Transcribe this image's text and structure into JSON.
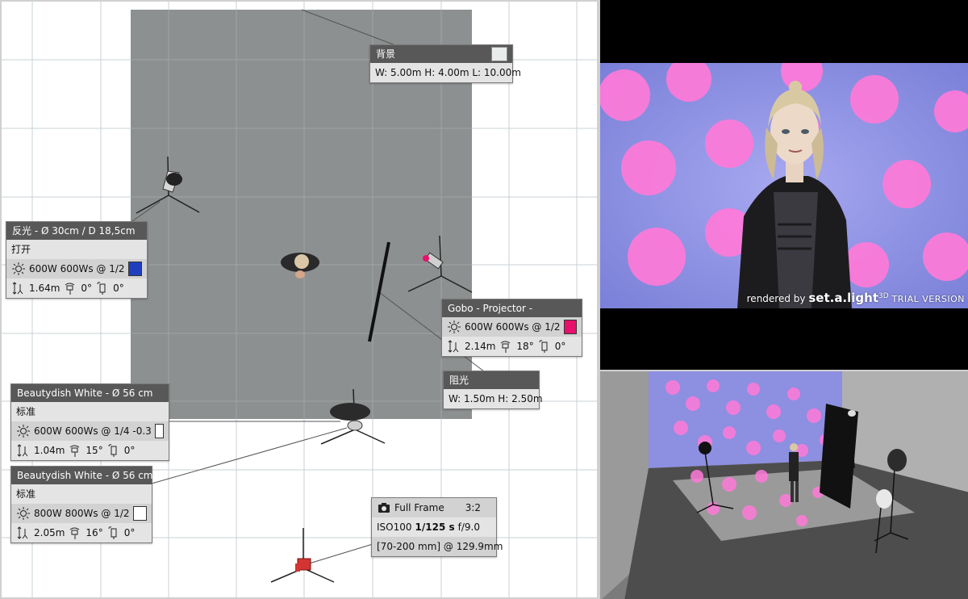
{
  "background_card": {
    "title": "背景",
    "dims": "W: 5.00m H: 4.00m L: 10.00m",
    "swatch_color": "#e8ecea"
  },
  "reflector_card": {
    "title": "反光 - Ø 30cm / D 18,5cm",
    "state": "打开",
    "power": "600W 600Ws @ 1/2",
    "swatch_color": "#1f3fbf",
    "height": "1.64m",
    "tilt": "0°",
    "rotate": "0°"
  },
  "gobo_card": {
    "title": "Gobo - Projector -",
    "power": "600W 600Ws @ 1/2",
    "swatch_color": "#e8106a",
    "height": "2.14m",
    "tilt": "18°",
    "rotate": "0°"
  },
  "flag_card": {
    "title": "阻光",
    "dims": "W: 1.50m H: 2.50m"
  },
  "beauty1_card": {
    "title": "Beautydish White - Ø 56 cm",
    "state": "标准",
    "power": "600W 600Ws @ 1/4 -0.3",
    "swatch_color": "#ffffff",
    "height": "1.04m",
    "tilt": "15°",
    "rotate": "0°"
  },
  "beauty2_card": {
    "title": "Beautydish White - Ø 56 cm",
    "state": "标准",
    "power": "800W 800Ws @ 1/2",
    "swatch_color": "#ffffff",
    "height": "2.05m",
    "tilt": "16°",
    "rotate": "0°"
  },
  "camera_card": {
    "sensor": "Full Frame",
    "ratio": "3:2",
    "iso": "ISO100",
    "shutter": "1/125 s",
    "aperture": "f/9.0",
    "lens": "[70-200 mm] @ 129.9mm"
  },
  "render": {
    "watermark_prefix": "rendered by",
    "brand": "set.a.light",
    "brand_suffix": "3D",
    "trial": "TRIAL VERSION"
  },
  "colors": {
    "backdrop_gray": "#8d9090",
    "card_header": "#585858",
    "card_body": "#e4e4e4",
    "grid_line": "#c8d0d4",
    "render_backdrop": "#8d8fe0",
    "render_dots": "#ff7ad9"
  }
}
